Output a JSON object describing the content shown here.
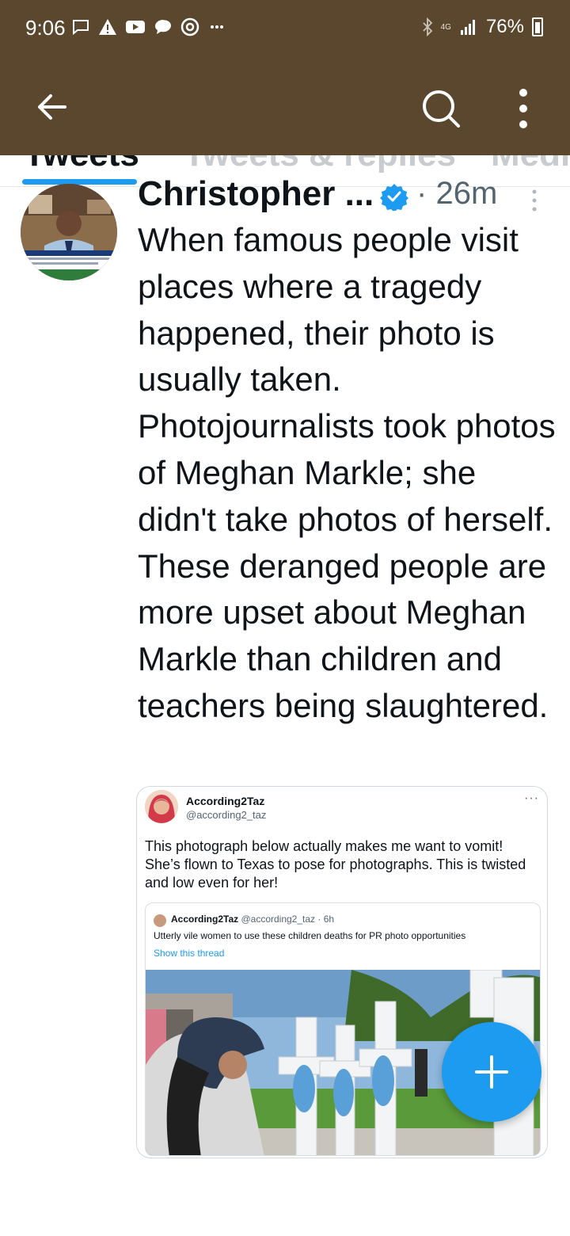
{
  "status_bar": {
    "time": "9:06",
    "notification_icons": [
      "message-icon",
      "warning-icon",
      "youtube-icon",
      "chat-icon",
      "chrome-icon",
      "more-dots-icon"
    ],
    "network": "4G",
    "battery": "76%"
  },
  "app_bar": {
    "back_icon": "arrow-left-icon",
    "search_icon": "search-icon",
    "more_icon": "more-vertical-icon",
    "color": "#5a472e"
  },
  "tabs": {
    "items": [
      {
        "label": "Tweets"
      },
      {
        "label": "Tweets & replies"
      },
      {
        "label": "Media"
      }
    ],
    "active_index": 0,
    "indicator_color": "#1d9bf0"
  },
  "tweet": {
    "author": "Christopher ...",
    "verified": true,
    "separator": "·",
    "time": "26m",
    "text": "When famous people visit places where a tragedy happened, their photo is usually taken. Photojournalists took photos of Meghan Markle; she didn't take photos of herself. These deranged people are more upset about Meghan Markle than children and teachers being slaughtered.",
    "quote": {
      "name": "According2Taz",
      "handle": "@according2_taz",
      "more": "···",
      "text": "This photograph below actually makes me want to vomit! She’s flown to Texas to pose for photographs. This is twisted and low even for her!",
      "inner": {
        "name": "According2Taz",
        "handle": "@according2_taz",
        "separator": "·",
        "time": "6h",
        "text": "Utterly vile women to use these children deaths for PR photo opportunities",
        "link": "Show this thread"
      }
    }
  },
  "fab": {
    "icon": "plus-icon",
    "color": "#1d9bf0"
  }
}
